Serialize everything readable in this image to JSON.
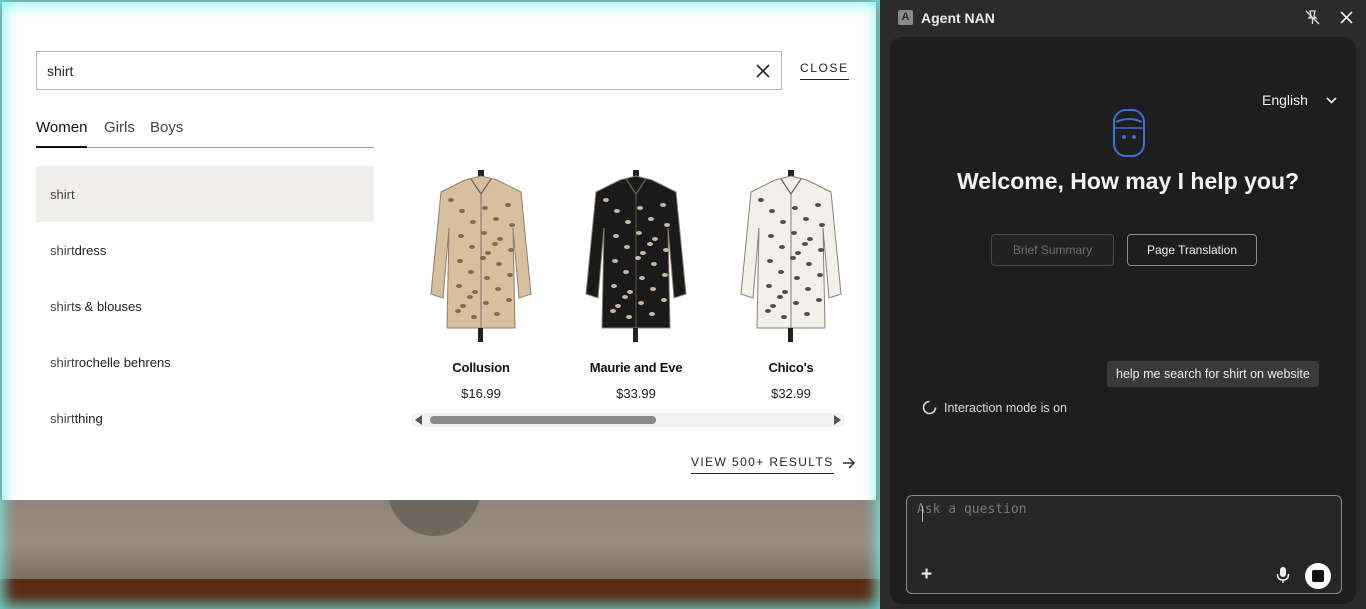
{
  "site": {
    "search": {
      "value": "shirt",
      "placeholder": ""
    },
    "close_label": "CLOSE",
    "tabs": [
      {
        "label": "Women",
        "active": true
      },
      {
        "label": "Girls",
        "active": false
      },
      {
        "label": "Boys",
        "active": false
      }
    ],
    "suggestions": [
      {
        "prefix": "shirt",
        "suffix": ""
      },
      {
        "prefix": "shirt",
        "suffix": "dress"
      },
      {
        "prefix": "shirt",
        "suffix": "s & blouses"
      },
      {
        "prefix": "shirt",
        "suffix": " rochelle behrens"
      },
      {
        "prefix": "shirt",
        "suffix": " thing"
      }
    ],
    "products": [
      {
        "brand": "Collusion",
        "price": "$16.99",
        "color": "#d8bf9e",
        "pattern": "#7a5a3a"
      },
      {
        "brand": "Maurie and Eve",
        "price": "$33.99",
        "color": "#1a1a1a",
        "pattern": "#e6d3b8"
      },
      {
        "brand": "Chico's",
        "price": "$32.99",
        "color": "#f2f0ea",
        "pattern": "#333333"
      }
    ],
    "view_all_label": "VIEW 500+ RESULTS"
  },
  "agent": {
    "title": "Agent NAN",
    "logo_letter": "A",
    "language": "English",
    "welcome": "Welcome, How may I help you?",
    "buttons": {
      "summary": "Brief Summary",
      "translation": "Page Translation"
    },
    "user_message": "help me search for shirt on website",
    "status": "Interaction mode is on",
    "input_placeholder": "Ask a question",
    "accent": "#3a6fd8"
  }
}
